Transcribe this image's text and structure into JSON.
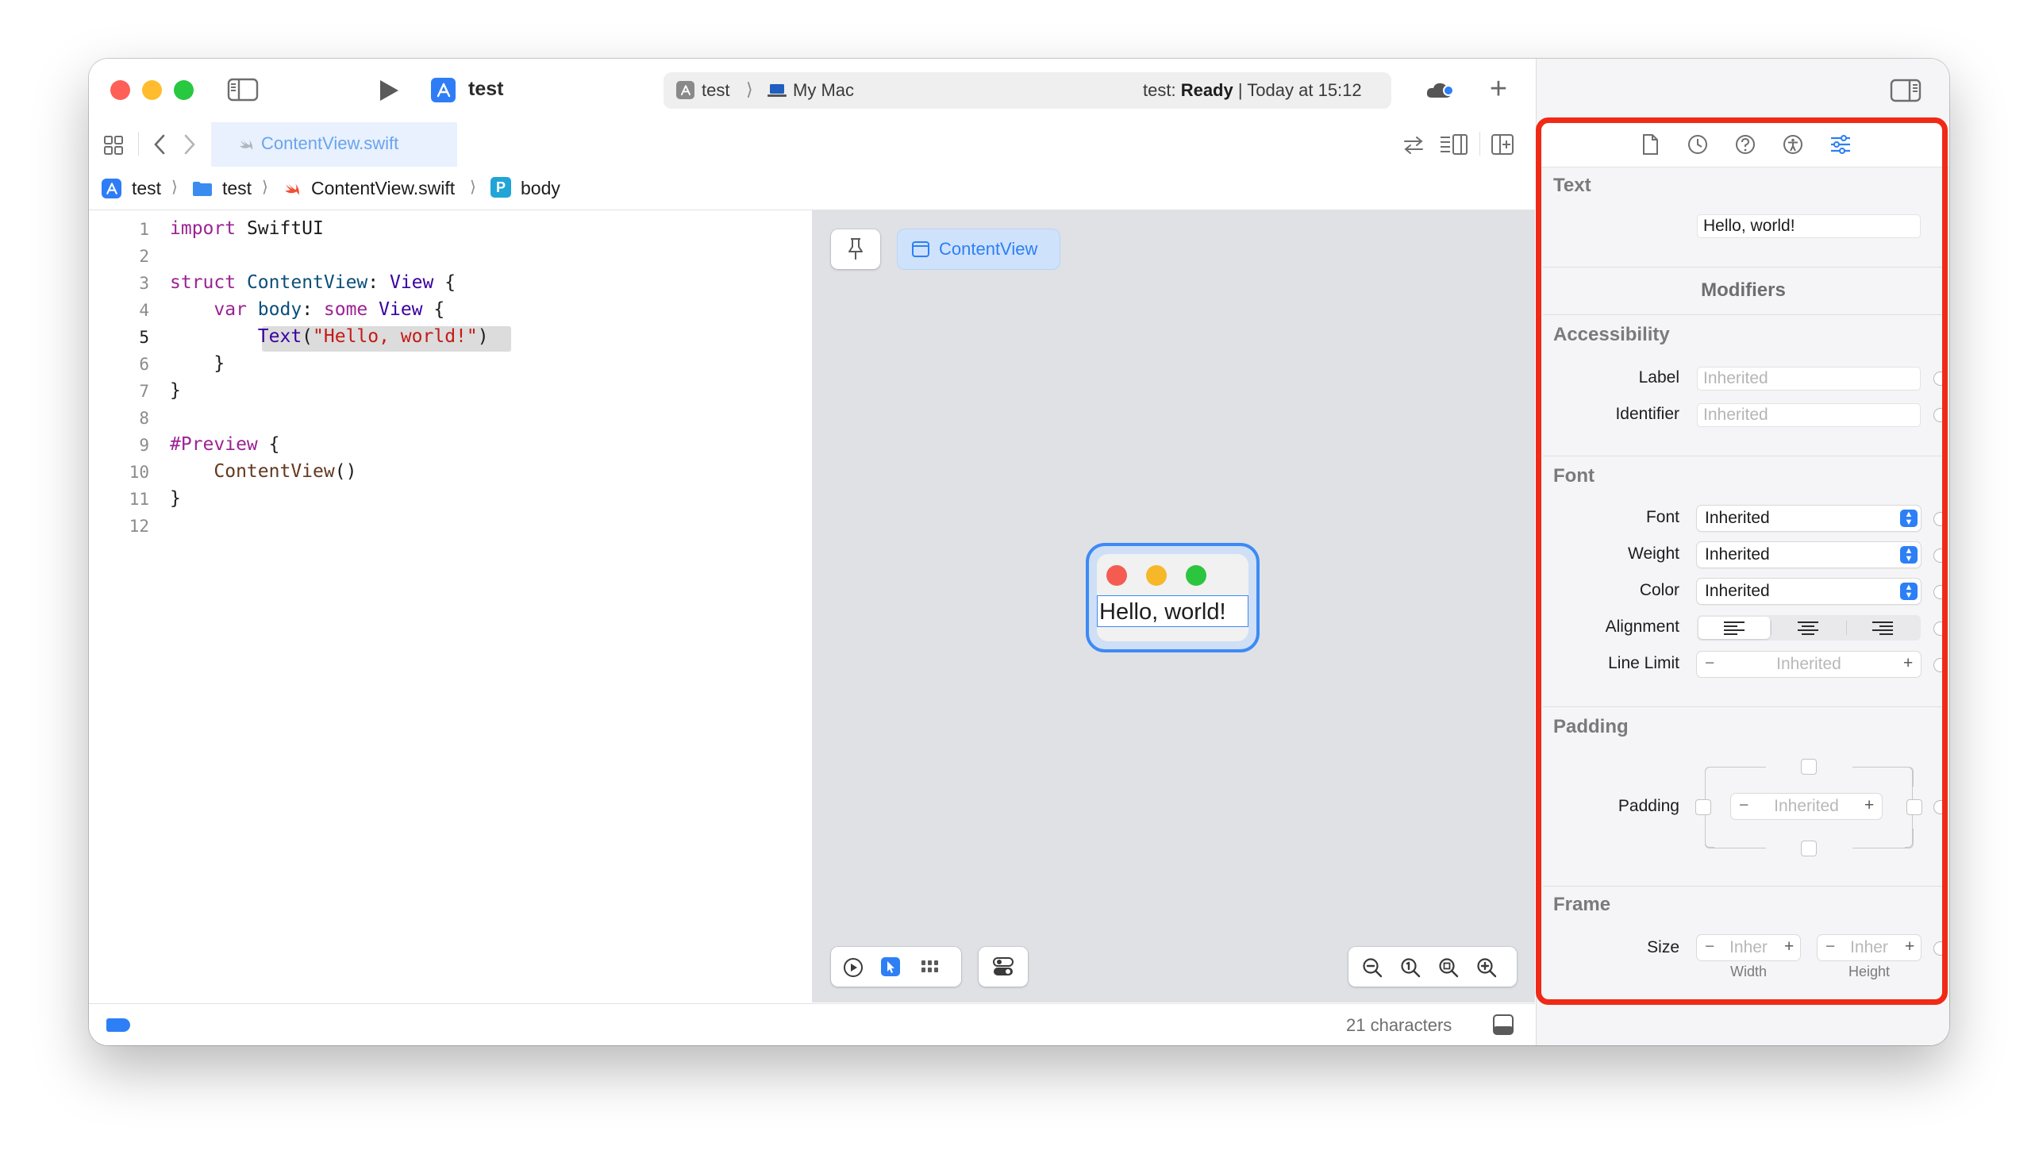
{
  "toolbar": {
    "scheme_name": "test",
    "breadcrumb_target": "test",
    "breadcrumb_destination": "My Mac",
    "status_project": "test:",
    "status_state": "Ready",
    "status_time": "| Today at 15:12",
    "add_label": "+"
  },
  "tab": {
    "label": "ContentView.swift"
  },
  "jumpbar": {
    "items": [
      "test",
      "test",
      "ContentView.swift",
      "body"
    ],
    "symbol_badge": "P"
  },
  "editor": {
    "line_numbers": [
      "1",
      "2",
      "3",
      "4",
      "5",
      "6",
      "7",
      "8",
      "9",
      "10",
      "11",
      "12"
    ],
    "current_line": "5"
  },
  "canvas": {
    "preview_tab": "ContentView",
    "preview_text": "Hello, world!"
  },
  "status": {
    "char_count": "21 characters"
  },
  "inspector": {
    "text_section": "Text",
    "text_value": "Hello, world!",
    "modifiers_title": "Modifiers",
    "accessibility": {
      "title": "Accessibility",
      "label_label": "Label",
      "label_placeholder": "Inherited",
      "identifier_label": "Identifier",
      "identifier_placeholder": "Inherited"
    },
    "font": {
      "title": "Font",
      "font_label": "Font",
      "font_value": "Inherited",
      "weight_label": "Weight",
      "weight_value": "Inherited",
      "color_label": "Color",
      "color_value": "Inherited",
      "alignment_label": "Alignment",
      "line_limit_label": "Line Limit",
      "line_limit_value": "Inherited"
    },
    "padding": {
      "title": "Padding",
      "label": "Padding",
      "value": "Inherited"
    },
    "frame": {
      "title": "Frame",
      "size_label": "Size",
      "width_value": "Inher",
      "height_value": "Inher",
      "width_caption": "Width",
      "height_caption": "Height"
    }
  },
  "colors": {
    "accent": "#2d7ff6",
    "highlight_box": "#f02a16",
    "close": "#fe5f57",
    "minimize": "#febc2e",
    "zoom": "#28c840"
  }
}
